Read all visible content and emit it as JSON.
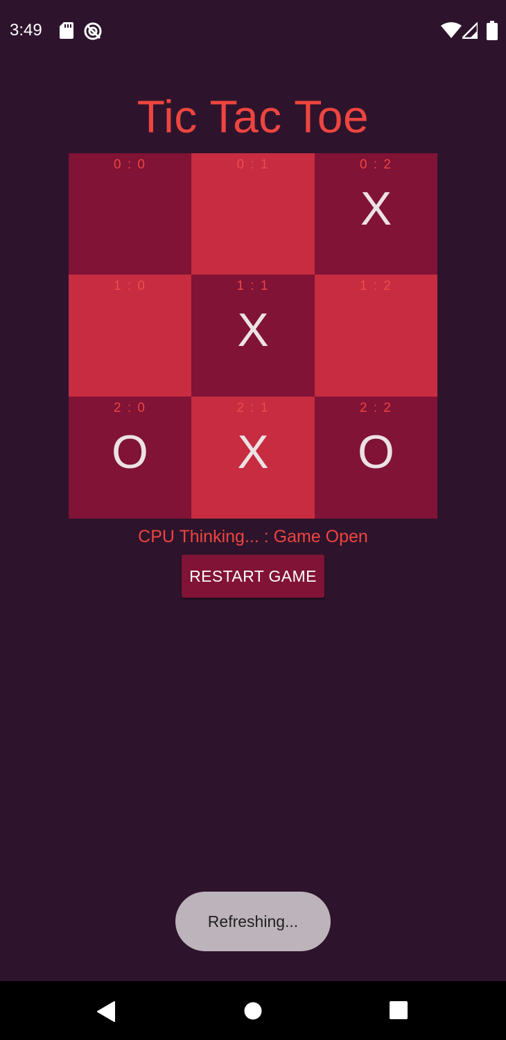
{
  "status_bar": {
    "time": "3:49",
    "icons": [
      "sd-card-icon",
      "do-not-disturb-icon",
      "wifi-icon",
      "cell-signal-icon",
      "battery-icon"
    ]
  },
  "app": {
    "title": "Tic Tac Toe"
  },
  "board": {
    "cells": [
      {
        "coord": "0 : 0",
        "mark": "",
        "shade": "dark"
      },
      {
        "coord": "0 : 1",
        "mark": "",
        "shade": "light"
      },
      {
        "coord": "0 : 2",
        "mark": "X",
        "shade": "dark"
      },
      {
        "coord": "1 : 0",
        "mark": "",
        "shade": "light"
      },
      {
        "coord": "1 : 1",
        "mark": "X",
        "shade": "dark"
      },
      {
        "coord": "1 : 2",
        "mark": "",
        "shade": "light"
      },
      {
        "coord": "2 : 0",
        "mark": "O",
        "shade": "dark"
      },
      {
        "coord": "2 : 1",
        "mark": "X",
        "shade": "light"
      },
      {
        "coord": "2 : 2",
        "mark": "O",
        "shade": "dark"
      }
    ]
  },
  "game": {
    "status_text": "CPU Thinking... : Game Open",
    "restart_label": "RESTART GAME"
  },
  "toast": {
    "text": "Refreshing..."
  },
  "nav": {
    "icons": [
      "back-icon",
      "home-icon",
      "recents-icon"
    ]
  },
  "colors": {
    "background": "#2d142c",
    "accent": "#ee4540",
    "cell_dark": "#801336",
    "cell_light": "#c72c41",
    "mark": "#ece2e6",
    "toast_bg": "#bdb3ba"
  }
}
